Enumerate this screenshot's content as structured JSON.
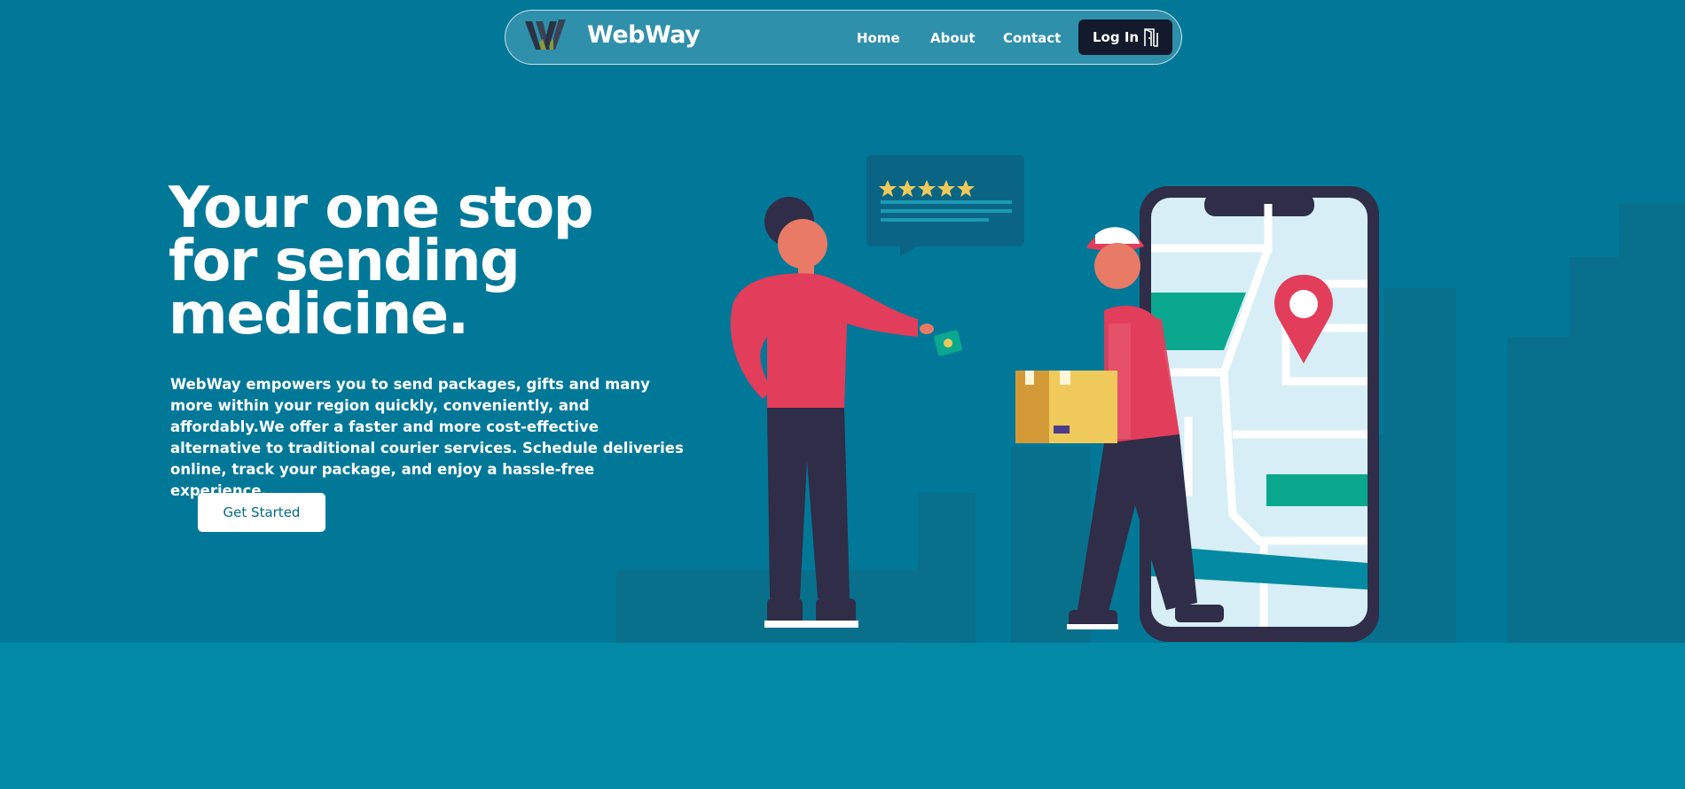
{
  "nav": {
    "brand": "WebWay",
    "links": [
      "Home",
      "About",
      "Contact"
    ],
    "login_label": "Log In"
  },
  "hero": {
    "title": "Your one stop for sending medicine.",
    "description": "WebWay empowers you to send packages, gifts and many more within your region quickly, conveniently, and affordably.We offer a faster and more cost-effective alternative to traditional courier services. Schedule deliveries online, track your package, and enjoy a hassle-free experience.",
    "cta_label": "Get Started"
  },
  "icons": {
    "logo": "webway-logo-icon",
    "login": "door-icon"
  },
  "colors": {
    "hero_background": "#027899",
    "lower_background": "#0289a6",
    "login_button": "#121a2b",
    "cta_text": "#046b86",
    "accent_red": "#e23d5a",
    "accent_yellow": "#f0c95b",
    "accent_green": "#0aa88f"
  }
}
